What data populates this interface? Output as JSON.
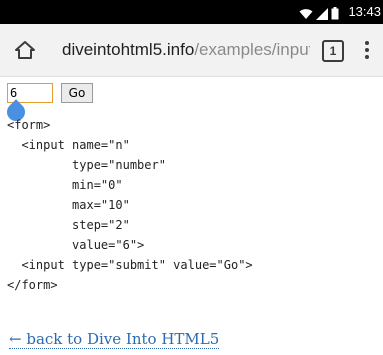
{
  "status_bar": {
    "time": "13:43",
    "icons": [
      "wifi-icon",
      "signal-icon",
      "battery-icon"
    ],
    "background": "#000000"
  },
  "browser": {
    "url_host": "diveintohtml5.info",
    "url_path": "/examples/input-",
    "tab_count": "1",
    "toolbar_background": "#f2f2f2",
    "home_icon": "home-icon",
    "menu_icon": "overflow-menu-icon"
  },
  "form": {
    "number_value": "6",
    "submit_label": "Go",
    "input_border_color": "#e69d2d"
  },
  "code_lines": [
    "<form>",
    "  <input name=\"n\"",
    "         type=\"number\"",
    "         min=\"0\"",
    "         max=\"10\"",
    "         step=\"2\"",
    "         value=\"6\">",
    "  <input type=\"submit\" value=\"Go\">",
    "</form>"
  ],
  "back_link": {
    "text": "← back to Dive Into HTML5",
    "color": "#2b6ab0"
  },
  "selection_handle_color": "#4a90e2"
}
